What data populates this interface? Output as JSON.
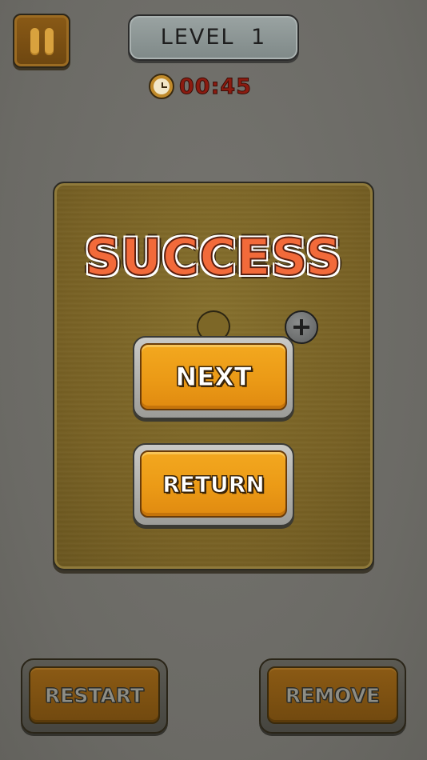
{
  "header": {
    "pause_icon": "pause-icon",
    "level_label": "LEVEL 1",
    "timer_icon": "clock-icon",
    "timer_value": "00:45"
  },
  "dialog": {
    "title": "SUCCESS",
    "plus_icon": "plus-icon",
    "next_label": "NEXT",
    "return_label": "RETURN"
  },
  "footer": {
    "restart_label": "RESTART",
    "remove_label": "REMOVE"
  },
  "colors": {
    "background": "#6e6d68",
    "panel": "#7b6425",
    "button_orange": "#f0a01b",
    "button_brown": "#7d5112",
    "title_orange": "#f26a3a",
    "timer_red": "#8c1b10"
  }
}
